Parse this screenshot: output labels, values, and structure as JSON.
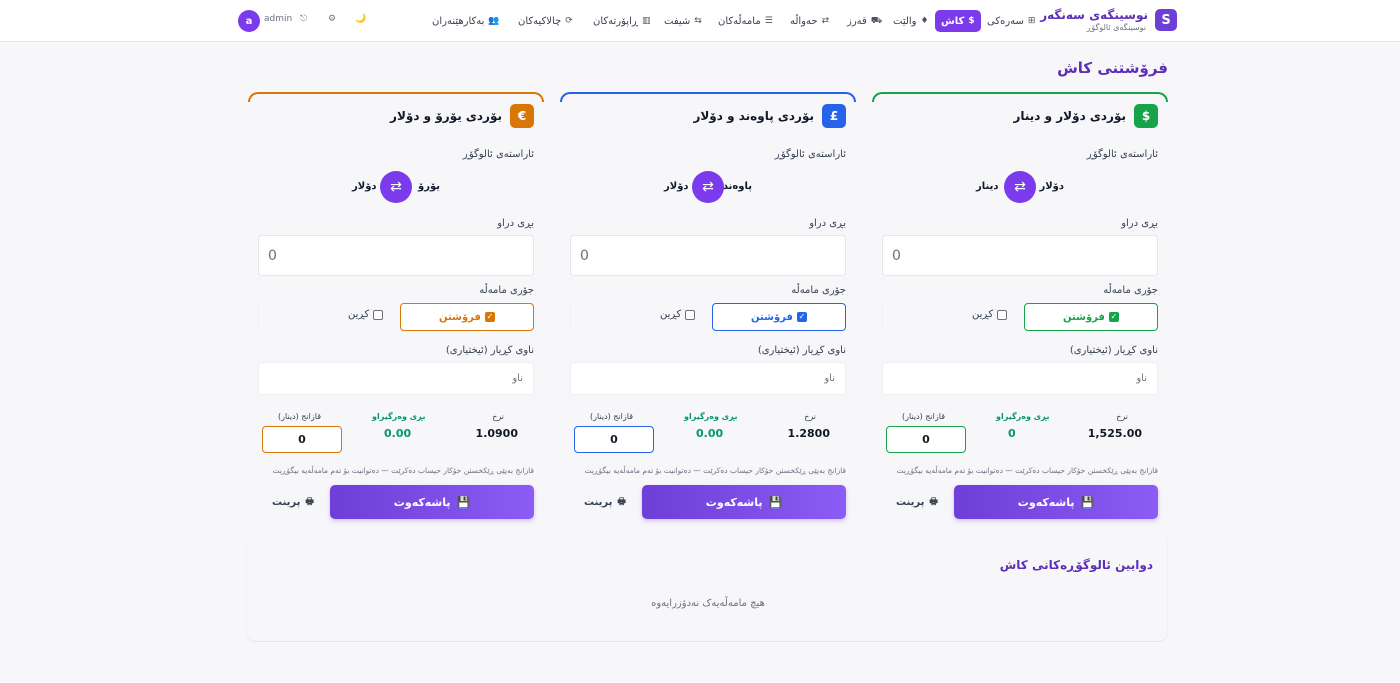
{
  "brand": {
    "logo_letter": "S",
    "title": "نوسینگەی سەنگەر",
    "subtitle": "نوسینگەی ئالوگۆڕ"
  },
  "nav": {
    "items": [
      {
        "label": "سەرەکی",
        "icon": "⊞"
      },
      {
        "label": "کاش",
        "icon": "$",
        "active": true
      },
      {
        "label": "والێت",
        "icon": "♦"
      },
      {
        "label": "قەرز",
        "icon": "⛟"
      },
      {
        "label": "حەواڵە",
        "icon": "⇄"
      },
      {
        "label": "مامەڵەکان",
        "icon": "☰"
      },
      {
        "label": "شیفت",
        "icon": "⇆"
      },
      {
        "label": "ڕاپۆرتەکان",
        "icon": "▥"
      },
      {
        "label": "چالاکیەکان",
        "icon": "⟳"
      },
      {
        "label": "بەکارهێنەران",
        "icon": "👥"
      }
    ],
    "theme_icon": "🌙",
    "settings_icon": "⚙",
    "logout_icon": "⎋",
    "user": {
      "avatar_letter": "a",
      "name": "admin"
    }
  },
  "page_title": "فرۆشتنی کاش",
  "labels": {
    "direction": "ئاراستەی ئالوگۆڕ",
    "amount": "بڕی دراو",
    "type": "جۆری مامەڵە",
    "sell": "فرۆشتن",
    "buy": "کڕین",
    "customer": "ناوی کڕیار (ئیختیاری)",
    "customer_placeholder": "ناو",
    "rate": "نرخ",
    "converted": "بڕی وەرگیراو",
    "profit": "قازانج (دینار)",
    "note": "قازانج بەپێی ڕێکخستن خۆکار حیساب دەکرێت — دەتوانیت بۆ تەم مامەڵەیە بیگۆڕیت",
    "save": "پاشەکەوت",
    "print": "پرینت"
  },
  "cards": [
    {
      "icon": "$",
      "accent": "#16a34a",
      "title": "بۆردی دۆلار و دینار",
      "from": "دۆلار",
      "to": "دینار",
      "amount": "0",
      "rate": "1,525.00",
      "converted": "0",
      "profit": "0"
    },
    {
      "icon": "£",
      "accent": "#2563eb",
      "title": "بۆردی پاوەند و دۆلار",
      "from": "پاوەند",
      "to": "دۆلار",
      "amount": "0",
      "rate": "1.2800",
      "converted": "0.00",
      "profit": "0"
    },
    {
      "icon": "€",
      "accent": "#d97706",
      "title": "بۆردی یۆرۆ و دۆلار",
      "from": "یۆرۆ",
      "to": "دۆلار",
      "amount": "0",
      "rate": "1.0900",
      "converted": "0.00",
      "profit": "0"
    }
  ],
  "recent": {
    "title": "دوایین ئالوگۆڕەکانی کاش",
    "empty": "هیچ مامەڵەیەک نەدۆزرایەوە"
  }
}
